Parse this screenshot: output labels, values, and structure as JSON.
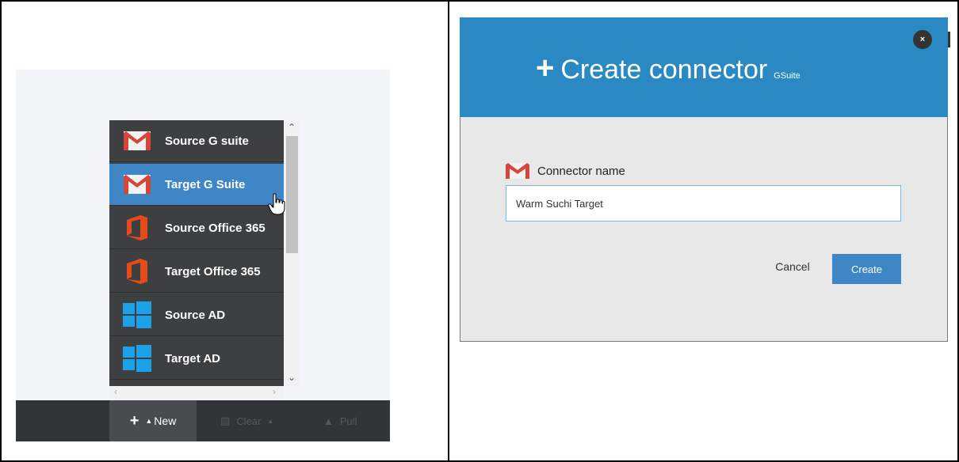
{
  "dropdown": {
    "items": [
      {
        "label": "Source G suite",
        "icon": "gmail-icon",
        "active": false
      },
      {
        "label": "Target G Suite",
        "icon": "gmail-icon",
        "active": true
      },
      {
        "label": "Source Office 365",
        "icon": "office365-icon",
        "active": false
      },
      {
        "label": "Target Office 365",
        "icon": "office365-icon",
        "active": false
      },
      {
        "label": "Source AD",
        "icon": "windows-icon",
        "active": false
      },
      {
        "label": "Target AD",
        "icon": "windows-icon",
        "active": false
      }
    ]
  },
  "toolbar": {
    "new_label": "New",
    "clear_label": "Clear",
    "pull_label": "Pull"
  },
  "dialog": {
    "title": "Create connector",
    "title_sub": "GSuite",
    "close_label": "×",
    "field_label": "Connector name",
    "field_value": "Warm Suchi Target",
    "cancel_label": "Cancel",
    "create_label": "Create"
  },
  "colors": {
    "header_blue": "#2a88c2",
    "active_item": "#3f86c7",
    "gmail_red": "#d44638",
    "office_orange": "#e64a19",
    "windows_blue": "#1aa1e8"
  }
}
